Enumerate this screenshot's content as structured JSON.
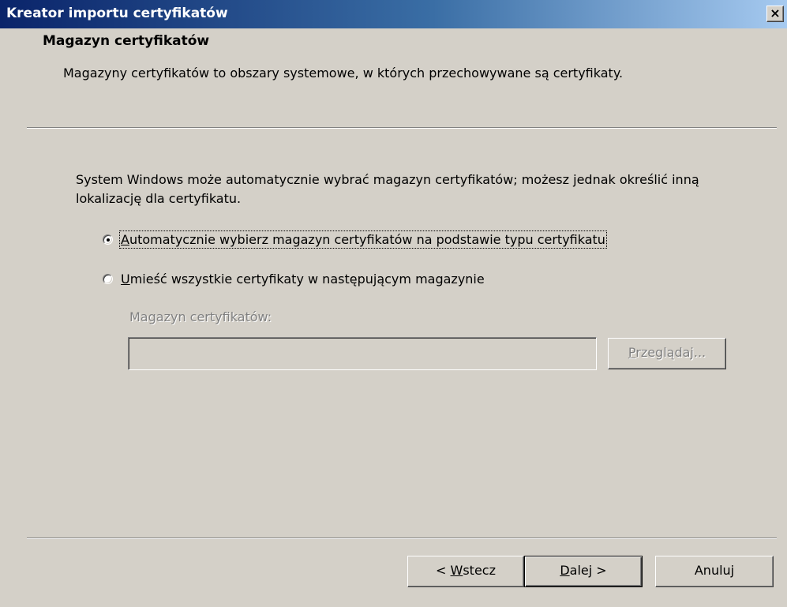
{
  "window": {
    "title": "Kreator importu certyfikatów",
    "close_glyph": "×",
    "close_icon": "close-icon"
  },
  "header": {
    "title": "Magazyn certyfikatów",
    "subtitle": "Magazyny certyfikatów to obszary systemowe, w których przechowywane są certyfikaty."
  },
  "body": {
    "intro": "System Windows może automatycznie wybrać magazyn certyfikatów; możesz jednak określić inną lokalizację dla certyfikatu.",
    "options": [
      {
        "accel": "A",
        "label_rest": "utomatycznie wybierz magazyn certyfikatów na podstawie typu certyfikatu",
        "selected": true
      },
      {
        "accel": "U",
        "label_rest": "mieść wszystkie certyfikaty w następującym magazynie",
        "selected": false
      }
    ],
    "store_label": "Magazyn certyfikatów:",
    "store_value": "",
    "browse": {
      "accel": "P",
      "rest": "rzeglądaj...",
      "enabled": false
    }
  },
  "footer": {
    "back": {
      "pre": "< ",
      "accel": "W",
      "rest": "stecz"
    },
    "next": {
      "accel": "D",
      "rest": "alej >"
    },
    "cancel": "Anuluj"
  },
  "colors": {
    "face": "#d4d0c8",
    "title_start": "#0a246a",
    "title_end": "#a6caf0",
    "disabled_text": "#808080"
  }
}
